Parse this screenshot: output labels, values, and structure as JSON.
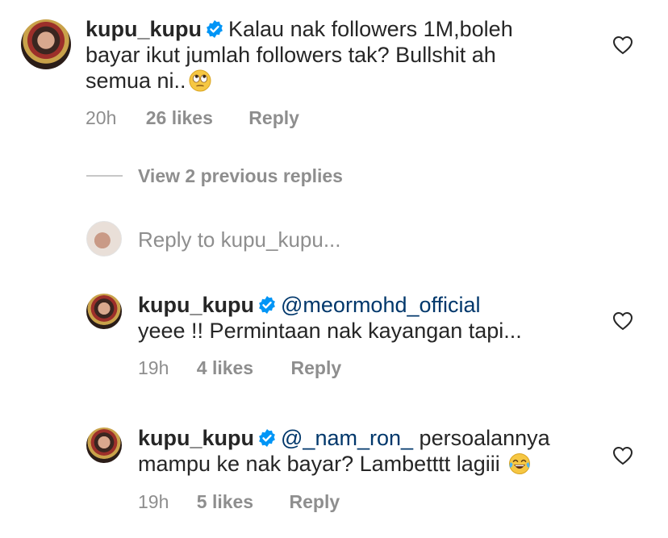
{
  "comment": {
    "username": "kupu_kupu",
    "text": "Kalau nak followers 1M,boleh bayar ikut jumlah followers tak? Bullshit ah semua ni..",
    "line1": "Kalau nak followers 1M,boleh",
    "line2": "bayar ikut jumlah followers tak? Bullshit ah",
    "line3": "semua ni..",
    "emoji": "face-with-rolling-eyes",
    "time": "20h",
    "likes": "26 likes",
    "reply_label": "Reply"
  },
  "view_previous": "View 2 previous replies",
  "reply_input": {
    "placeholder": "Reply to kupu_kupu..."
  },
  "replies": [
    {
      "username": "kupu_kupu",
      "mention": "@meormohd_official",
      "text": "yeee !! Permintaan nak kayangan tapi...",
      "time": "19h",
      "likes": "4 likes",
      "reply_label": "Reply"
    },
    {
      "username": "kupu_kupu",
      "mention": "@_nam_ron_",
      "text_line1": "persoalannya",
      "text_line2": "mampu ke nak bayar? Lambetttt lagiii",
      "emoji": "face-with-tears-of-joy",
      "time": "19h",
      "likes": "5 likes",
      "reply_label": "Reply"
    }
  ],
  "colors": {
    "text": "#262626",
    "secondary": "#8e8e8e",
    "mention": "#00376b",
    "verified": "#0095f6"
  }
}
